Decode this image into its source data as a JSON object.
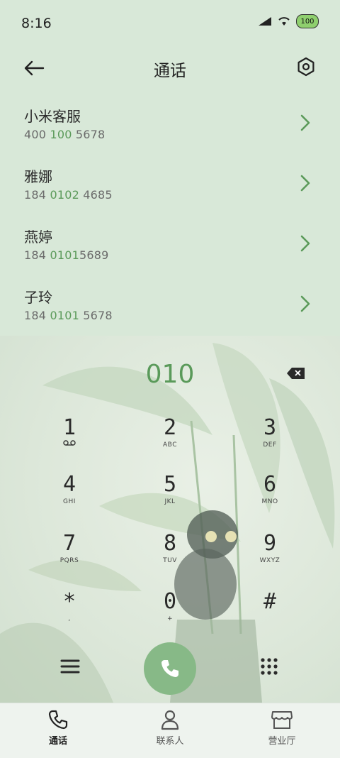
{
  "status_bar": {
    "time": "8:16",
    "battery": "100"
  },
  "header": {
    "title": "通话"
  },
  "contacts": [
    {
      "name": "小米客服",
      "number_parts": [
        "400 ",
        "100",
        " 5678"
      ]
    },
    {
      "name": "雅娜",
      "number_parts": [
        "184 ",
        "0102",
        " 4685"
      ]
    },
    {
      "name": "燕婷",
      "number_parts": [
        "184 ",
        "0101",
        "5689"
      ]
    },
    {
      "name": "子玲",
      "number_parts": [
        "184 ",
        "0101",
        " 5678"
      ]
    }
  ],
  "dialpad": {
    "dialed_number": "010",
    "keys": [
      {
        "digit": "1",
        "sub": ""
      },
      {
        "digit": "2",
        "sub": "ABC"
      },
      {
        "digit": "3",
        "sub": "DEF"
      },
      {
        "digit": "4",
        "sub": "GHI"
      },
      {
        "digit": "5",
        "sub": "JKL"
      },
      {
        "digit": "6",
        "sub": "MNO"
      },
      {
        "digit": "7",
        "sub": "PQRS"
      },
      {
        "digit": "8",
        "sub": "TUV"
      },
      {
        "digit": "9",
        "sub": "WXYZ"
      },
      {
        "digit": "*",
        "sub": ","
      },
      {
        "digit": "0",
        "sub": "+"
      },
      {
        "digit": "#",
        "sub": ""
      }
    ]
  },
  "bottom_nav": [
    {
      "label": "通话",
      "icon": "phone-icon",
      "active": true
    },
    {
      "label": "联系人",
      "icon": "person-icon",
      "active": false
    },
    {
      "label": "营业厅",
      "icon": "store-icon",
      "active": false
    }
  ],
  "colors": {
    "accent": "#5b9a5a",
    "call_button": "#87b987",
    "background": "#d8e8d8"
  }
}
